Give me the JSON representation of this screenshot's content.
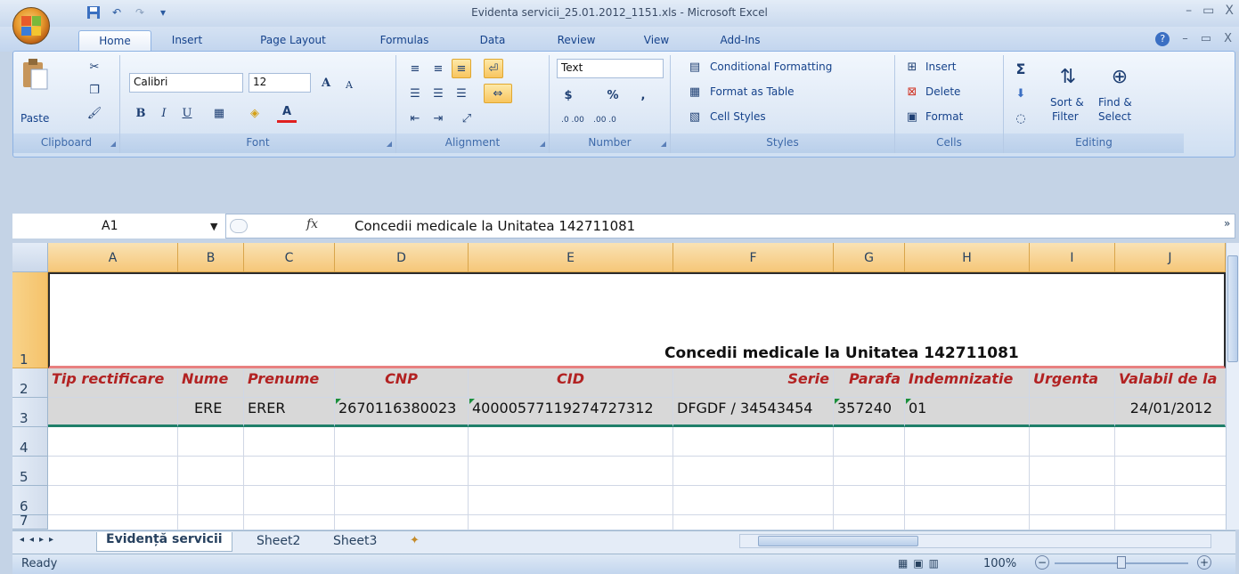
{
  "window": {
    "title": "Evidenta servicii_25.01.2012_1151.xls - Microsoft Excel",
    "minimize": "–",
    "restore": "▭",
    "close": "X"
  },
  "workbook_controls": {
    "help": "?",
    "minimize": "–",
    "restore": "▭",
    "close": "X"
  },
  "tabs": [
    "Home",
    "Insert",
    "Page Layout",
    "Formulas",
    "Data",
    "Review",
    "View",
    "Add-Ins"
  ],
  "ribbon": {
    "clipboard": {
      "paste": "Paste",
      "group": "Clipboard"
    },
    "font": {
      "name": "Calibri",
      "size": "12",
      "bold": "B",
      "italic": "I",
      "underline": "U",
      "grow": "A",
      "shrink": "A",
      "color": "A",
      "group": "Font"
    },
    "alignment": {
      "group": "Alignment"
    },
    "number": {
      "format": "Text",
      "currency": "$",
      "percent": "%",
      "comma": ",",
      "inc_decimal": ".0 .00",
      "dec_decimal": ".00 .0",
      "group": "Number"
    },
    "styles": {
      "conditional": "Conditional Formatting",
      "table": "Format as Table",
      "cell_styles": "Cell Styles",
      "group": "Styles"
    },
    "cells": {
      "insert": "Insert",
      "delete": "Delete",
      "format": "Format",
      "group": "Cells"
    },
    "editing": {
      "sum": "Σ",
      "sort_filter_1": "Sort &",
      "sort_filter_2": "Filter",
      "find_select_1": "Find &",
      "find_select_2": "Select",
      "group": "Editing"
    }
  },
  "formula_bar": {
    "name_box": "A1",
    "fx": "fx",
    "content": "Concedii medicale la Unitatea 142711081"
  },
  "columns": [
    "A",
    "B",
    "C",
    "D",
    "E",
    "F",
    "G",
    "H",
    "I",
    "J"
  ],
  "rows": [
    "1",
    "2",
    "3",
    "4",
    "5",
    "6",
    "7"
  ],
  "sheet": {
    "title": "Concedii medicale la Unitatea 142711081",
    "headers": [
      "Tip rectificare",
      "Nume",
      "Prenume",
      "CNP",
      "CID",
      "Serie",
      "Parafa",
      "Indemnizatie",
      "Urgenta",
      "Valabil de la"
    ],
    "row3": [
      "",
      "ERE",
      "ERER",
      "2670116380023",
      "40000577119274727312",
      "DFGDF / 34543454",
      "357240",
      "01",
      "",
      "24/01/2012"
    ]
  },
  "sheet_tabs": [
    "Evidență servicii",
    "Sheet2",
    "Sheet3"
  ],
  "status": {
    "ready": "Ready",
    "zoom": "100%",
    "zoom_minus": "−",
    "zoom_plus": "+"
  },
  "colors": {
    "header_text": "#b22222",
    "title_rule": "#e88080",
    "data_rule": "#1f7f6a",
    "row3_fill": "#d8d8d8"
  }
}
